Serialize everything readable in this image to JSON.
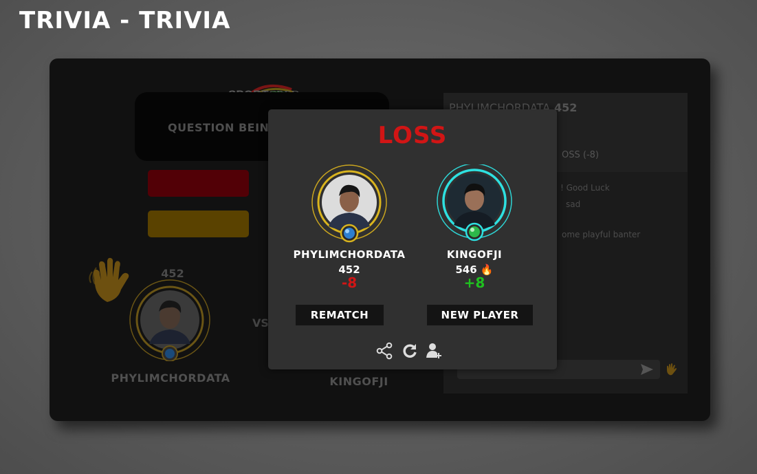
{
  "page": {
    "title": "TRIVIA - TRIVIA"
  },
  "game": {
    "logo": {
      "bold": "SPORT",
      "regular": "CRED"
    },
    "question_text": "QUESTION BEIN",
    "left_player": {
      "score": "452",
      "name": "PHYLIMCHORDATA"
    },
    "vs": "VS",
    "right_player": {
      "name": "KINGOFJI"
    }
  },
  "chat": {
    "header_name": "PHYLIMCHORDATA",
    "header_score": "452",
    "result_line": "OSS (-8)",
    "messages": [
      "! Good Luck",
      "sad",
      "ome playful banter"
    ]
  },
  "modal": {
    "result": "LOSS",
    "left": {
      "name": "PHYLIMCHORDATA",
      "score": "452",
      "delta": "-8"
    },
    "right": {
      "name": "KINGOFJI",
      "score": "546",
      "delta": "+8"
    },
    "rematch_label": "REMATCH",
    "new_player_label": "NEW PLAYER",
    "icons": [
      "share-icon",
      "refresh-icon",
      "add-friend-icon"
    ]
  },
  "colors": {
    "loss": "#d11515",
    "gain": "#1fc11f",
    "left_ring": "#c9a51f",
    "right_ring": "#2ed4d4"
  }
}
